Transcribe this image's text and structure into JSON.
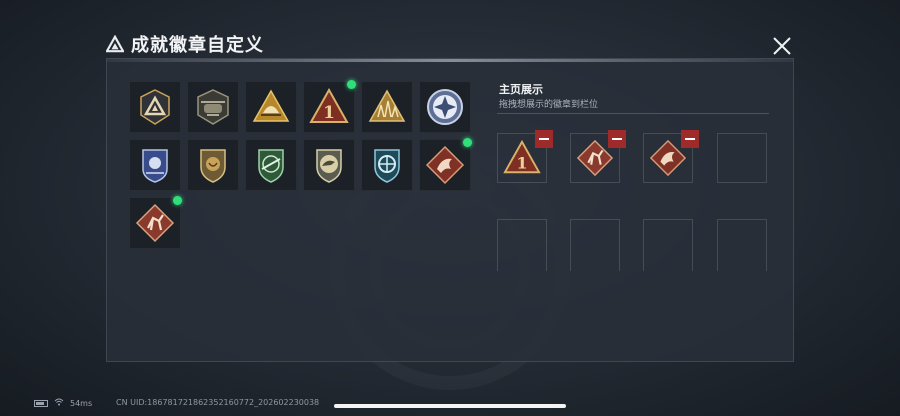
{
  "header": {
    "title": "成就徽章自定义",
    "title_icon": "triangle-logo-icon",
    "close_icon": "close-x-icon"
  },
  "collection": {
    "badges": [
      {
        "name": "triangle-emblem-icon",
        "new": false
      },
      {
        "name": "helicopter-badge-icon",
        "new": false
      },
      {
        "name": "helmet-triangle-badge-icon",
        "new": false
      },
      {
        "name": "number-one-badge-icon",
        "new": true
      },
      {
        "name": "grass-triangle-badge-icon",
        "new": false
      },
      {
        "name": "star-compass-badge-icon",
        "new": false
      },
      {
        "name": "blue-police-shield-icon",
        "new": false
      },
      {
        "name": "lion-shield-icon",
        "new": false
      },
      {
        "name": "green-rifle-shield-icon",
        "new": false
      },
      {
        "name": "raptor-shield-icon",
        "new": false
      },
      {
        "name": "blue-target-shield-icon",
        "new": false
      },
      {
        "name": "dragon-diamond-badge-icon",
        "new": true
      },
      {
        "name": "climber-diamond-badge-icon",
        "new": true
      }
    ]
  },
  "display": {
    "title": "主页展示",
    "subtitle": "拖拽想展示的徽章到栏位",
    "slots": [
      {
        "badge": "number-one-badge-icon",
        "filled": true
      },
      {
        "badge": "climber-diamond-badge-icon",
        "filled": true
      },
      {
        "badge": "dragon-diamond-badge-icon",
        "filled": true
      },
      {
        "badge": "",
        "filled": false
      },
      {
        "badge": "",
        "filled": false
      },
      {
        "badge": "",
        "filled": false
      },
      {
        "badge": "",
        "filled": false
      },
      {
        "badge": "",
        "filled": false
      }
    ],
    "remove_icon": "remove-minus-icon"
  },
  "status": {
    "ping": "54ms",
    "uid": "CN UID:18678172186235216077​2_202602230038",
    "wifi_icon": "wifi-icon",
    "battery_icon": "battery-icon"
  },
  "colors": {
    "accent_gold": "#c9a35a",
    "badge_red": "#8a3a2c",
    "remove_red": "#9e2a2a",
    "new_dot": "#2fe07a"
  }
}
